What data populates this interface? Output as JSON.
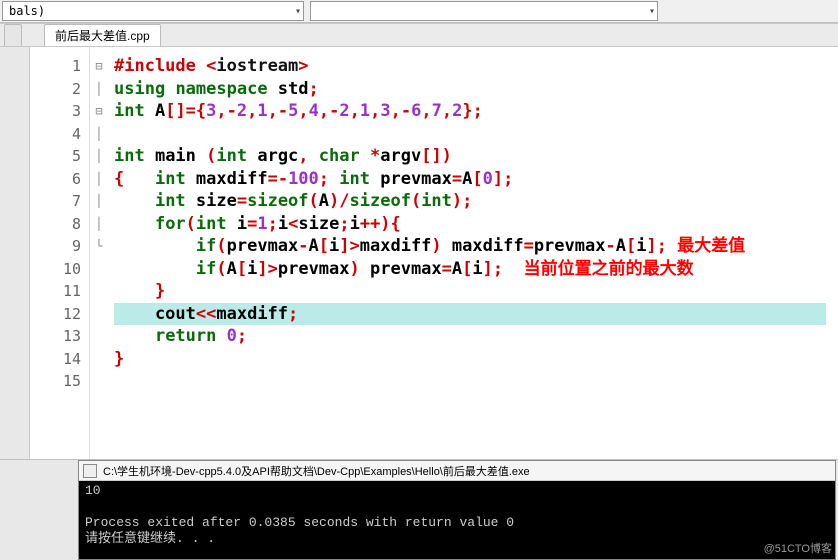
{
  "toolbar": {
    "combo1": "bals)"
  },
  "tab": {
    "name": "前后最大差值.cpp"
  },
  "code": {
    "lines": [
      {
        "n": "1",
        "fold": "",
        "html": "<span class='op'>#include</span> <span class='op'>&lt;</span><span class='fn'>iostream</span><span class='op'>&gt;</span>"
      },
      {
        "n": "2",
        "fold": "",
        "html": "<span class='kw'>using</span> <span class='kw'>namespace</span> std<span class='op'>;</span>"
      },
      {
        "n": "3",
        "fold": "",
        "html": "<span class='kw'>int</span> A<span class='op'>[]={</span><span class='num'>3</span><span class='op'>,-</span><span class='num'>2</span><span class='op'>,</span><span class='num'>1</span><span class='op'>,-</span><span class='num'>5</span><span class='op'>,</span><span class='num'>4</span><span class='op'>,-</span><span class='num'>2</span><span class='op'>,</span><span class='num'>1</span><span class='op'>,</span><span class='num'>3</span><span class='op'>,-</span><span class='num'>6</span><span class='op'>,</span><span class='num'>7</span><span class='op'>,</span><span class='num'>2</span><span class='op'>};</span>"
      },
      {
        "n": "4",
        "fold": "",
        "html": ""
      },
      {
        "n": "5",
        "fold": "",
        "html": "<span class='kw'>int</span> main <span class='op'>(</span><span class='kw'>int</span> argc<span class='op'>,</span> <span class='kw'>char</span> <span class='op'>*</span>argv<span class='op'>[])</span>"
      },
      {
        "n": "6",
        "fold": "⊟",
        "html": "<span class='op'>{</span>   <span class='kw'>int</span> maxdiff<span class='op'>=-</span><span class='num'>100</span><span class='op'>;</span> <span class='kw'>int</span> prevmax<span class='op'>=</span>A<span class='op'>[</span><span class='num'>0</span><span class='op'>];</span>"
      },
      {
        "n": "7",
        "fold": "│",
        "html": "    <span class='kw'>int</span> size<span class='op'>=</span><span class='kw'>sizeof</span><span class='op'>(</span>A<span class='op'>)/</span><span class='kw'>sizeof</span><span class='op'>(</span><span class='kw'>int</span><span class='op'>);</span>"
      },
      {
        "n": "8",
        "fold": "⊟",
        "html": "    <span class='kw'>for</span><span class='op'>(</span><span class='kw'>int</span> i<span class='op'>=</span><span class='num'>1</span><span class='op'>;</span>i<span class='op'>&lt;</span>size<span class='op'>;</span>i<span class='op'>++){</span>"
      },
      {
        "n": "9",
        "fold": "│",
        "html": "        <span class='kw'>if</span><span class='op'>(</span>prevmax<span class='op'>-</span>A<span class='op'>[</span>i<span class='op'>]&gt;</span>maxdiff<span class='op'>)</span> maxdiff<span class='op'>=</span>prevmax<span class='op'>-</span>A<span class='op'>[</span>i<span class='op'>];</span> <span class='cmt'>最大差值</span>"
      },
      {
        "n": "10",
        "fold": "│",
        "html": "        <span class='kw'>if</span><span class='op'>(</span>A<span class='op'>[</span>i<span class='op'>]&gt;</span>prevmax<span class='op'>)</span> prevmax<span class='op'>=</span>A<span class='op'>[</span>i<span class='op'>];</span>  <span class='cmt'>当前位置之前的最大数</span>"
      },
      {
        "n": "11",
        "fold": "│",
        "html": "    <span class='op'>}</span>"
      },
      {
        "n": "12",
        "fold": "│",
        "html": "    cout<span class='op'>&lt;&lt;</span>maxdiff<span class='op'>;</span>",
        "highlight": true
      },
      {
        "n": "13",
        "fold": "│",
        "html": "    <span class='kw'>return</span> <span class='num'>0</span><span class='op'>;</span>"
      },
      {
        "n": "14",
        "fold": "└",
        "html": "<span class='op'>}</span>"
      },
      {
        "n": "15",
        "fold": "",
        "html": ""
      }
    ]
  },
  "console": {
    "title": "C:\\学生机环境-Dev-cpp5.4.0及API帮助文档\\Dev-Cpp\\Examples\\Hello\\前后最大差值.exe",
    "output": "10\n\nProcess exited after 0.0385 seconds with return value 0\n请按任意键继续. . ."
  },
  "watermark": "@51CTO博客"
}
